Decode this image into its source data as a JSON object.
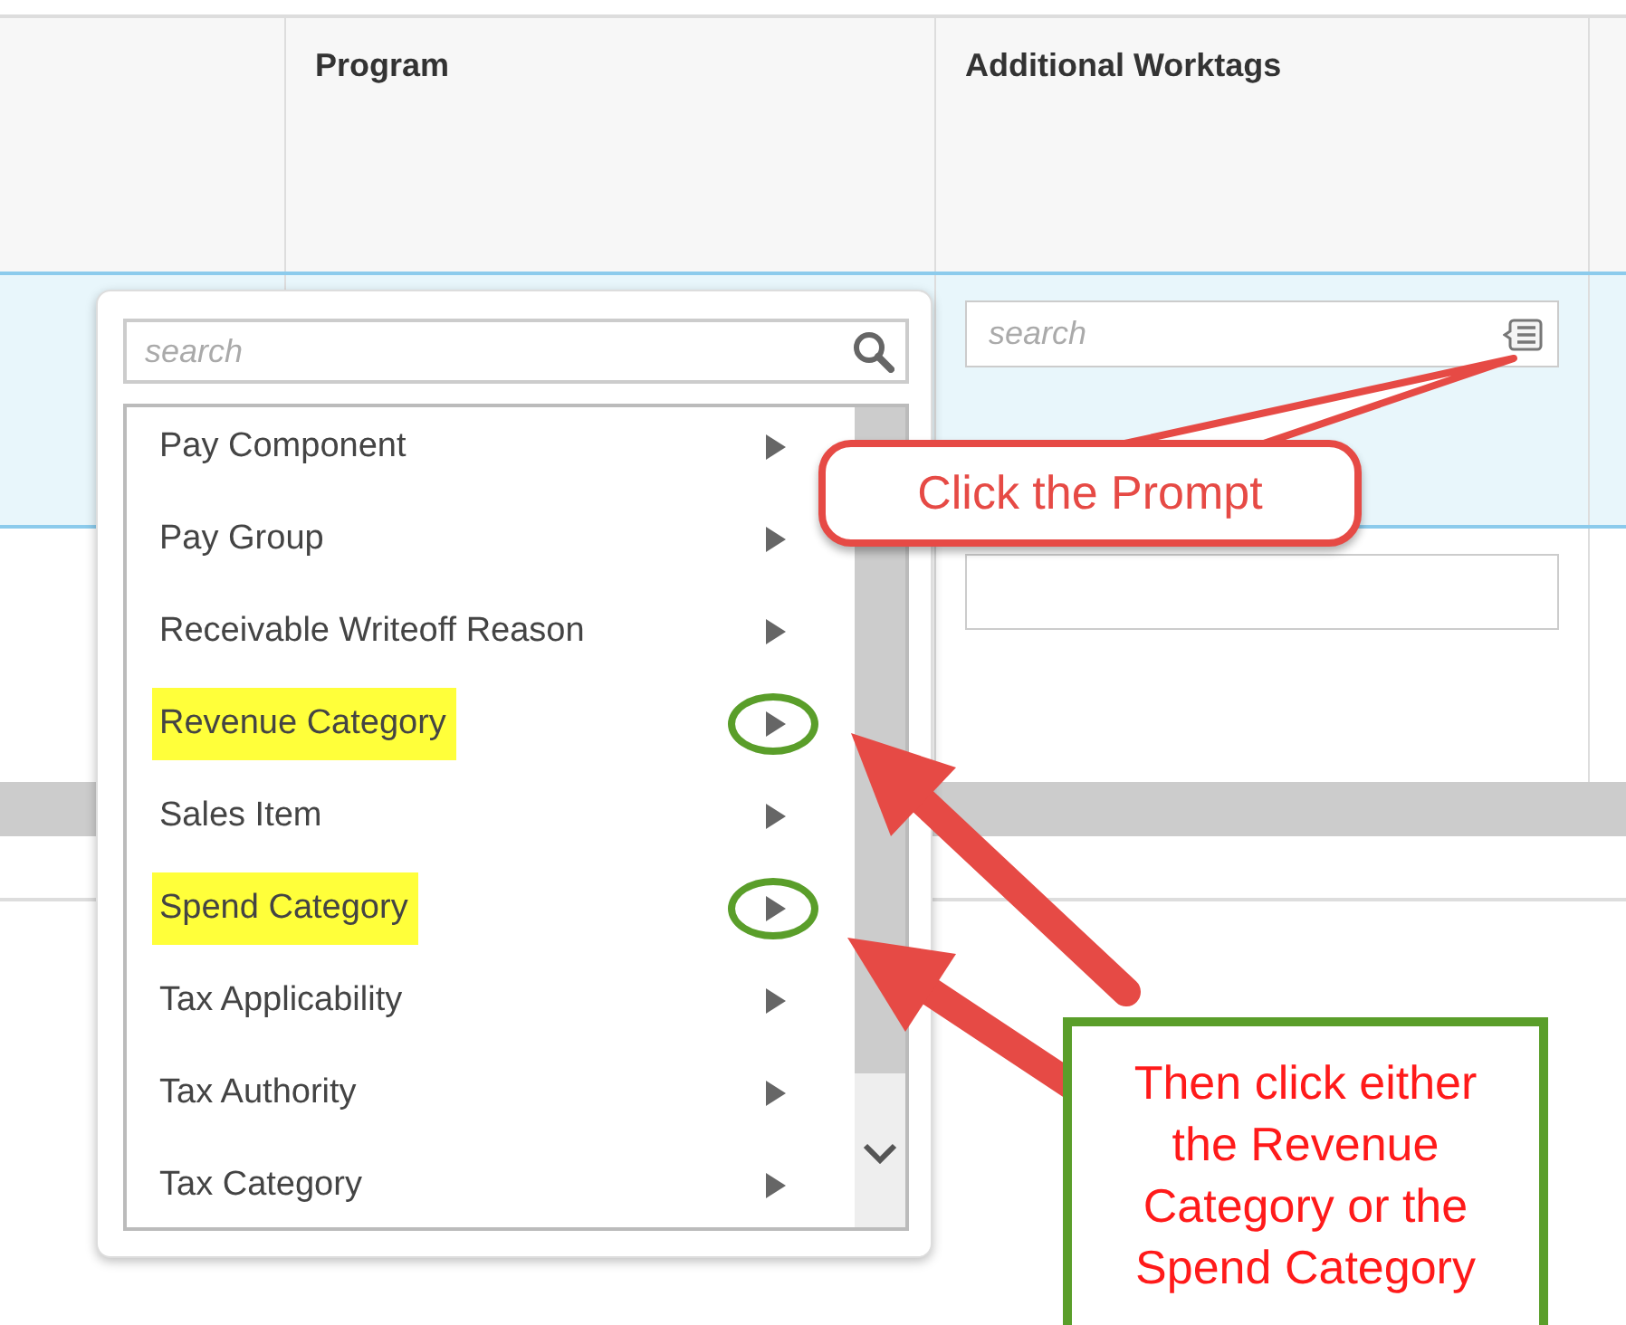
{
  "table": {
    "columns": [
      {
        "label": "Program"
      },
      {
        "label": "Additional Worktags"
      }
    ],
    "row_field": {
      "placeholder": "search"
    }
  },
  "popup": {
    "search": {
      "placeholder": "search"
    },
    "items": [
      {
        "label": "Pay Component",
        "highlighted": false,
        "circled": false
      },
      {
        "label": "Pay Group",
        "highlighted": false,
        "circled": false
      },
      {
        "label": "Receivable Writeoff Reason",
        "highlighted": false,
        "circled": false
      },
      {
        "label": "Revenue Category",
        "highlighted": true,
        "circled": true
      },
      {
        "label": "Sales Item",
        "highlighted": false,
        "circled": false
      },
      {
        "label": "Spend Category",
        "highlighted": true,
        "circled": true
      },
      {
        "label": "Tax Applicability",
        "highlighted": false,
        "circled": false
      },
      {
        "label": "Tax Authority",
        "highlighted": false,
        "circled": false
      },
      {
        "label": "Tax Category",
        "highlighted": false,
        "circled": false
      }
    ]
  },
  "annotations": [
    {
      "kind": "callout",
      "text": "Click the Prompt"
    },
    {
      "kind": "note",
      "text": "Then click either the Revenue Category or the Spend Category"
    }
  ]
}
